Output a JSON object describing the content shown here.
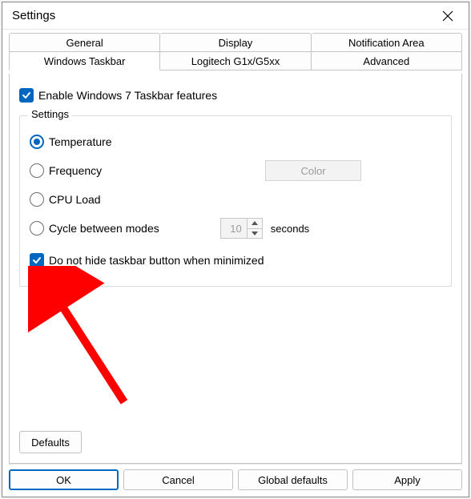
{
  "window": {
    "title": "Settings"
  },
  "tabs": {
    "row1": [
      {
        "label": "General"
      },
      {
        "label": "Display"
      },
      {
        "label": "Notification Area"
      }
    ],
    "row2": [
      {
        "label": "Windows Taskbar",
        "active": true
      },
      {
        "label": "Logitech G1x/G5xx"
      },
      {
        "label": "Advanced"
      }
    ]
  },
  "panel": {
    "enable_label": "Enable Windows 7 Taskbar features",
    "group_title": "Settings",
    "radio_temperature": "Temperature",
    "radio_frequency": "Frequency",
    "radio_cpuload": "CPU Load",
    "radio_cycle": "Cycle between modes",
    "color_btn": "Color",
    "cycle_seconds_value": "10",
    "seconds_suffix": "seconds",
    "hide_label": "Do not hide taskbar button when minimized",
    "defaults_btn": "Defaults"
  },
  "footer": {
    "ok": "OK",
    "cancel": "Cancel",
    "global_defaults": "Global defaults",
    "apply": "Apply"
  }
}
